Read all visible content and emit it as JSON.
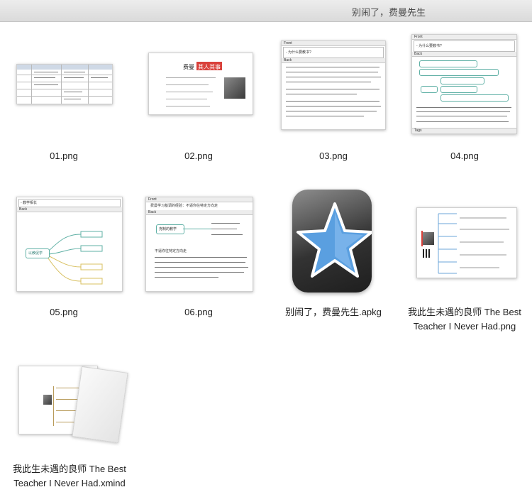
{
  "window": {
    "title": "别闹了，费曼先生"
  },
  "files": [
    {
      "name": "01.png"
    },
    {
      "name": "02.png",
      "thumb_text": {
        "title_part1": "费曼",
        "title_part2": "其人其事"
      }
    },
    {
      "name": "03.png",
      "thumb_text": {
        "front": "Front",
        "q": "- 为什么要教书?",
        "back": "Back"
      }
    },
    {
      "name": "04.png",
      "thumb_text": {
        "front": "Front",
        "q": "- 为什么要教书?",
        "back": "Back",
        "tags": "Tags"
      }
    },
    {
      "name": "05.png",
      "thumb_text": {
        "q": "- 教学相长",
        "back": "Back",
        "center": "以教促学"
      }
    },
    {
      "name": "06.png",
      "thumb_text": {
        "front": "Front",
        "q": "费曼学习基调的经验：不逼你往特定方向走",
        "back": "Back",
        "node": "克制的教学",
        "para": "不逼你往特定方向走"
      }
    },
    {
      "name": "别闹了，费曼先生.apkg"
    },
    {
      "name": "我此生未遇的良师 The Best Teacher I Never Had.png"
    },
    {
      "name": "我此生未遇的良师 The Best Teacher I Never Had.xmind"
    }
  ],
  "colors": {
    "star_blue": "#5a9fe0",
    "accent_red": "#d9413b",
    "teal": "#5fb0a5"
  }
}
